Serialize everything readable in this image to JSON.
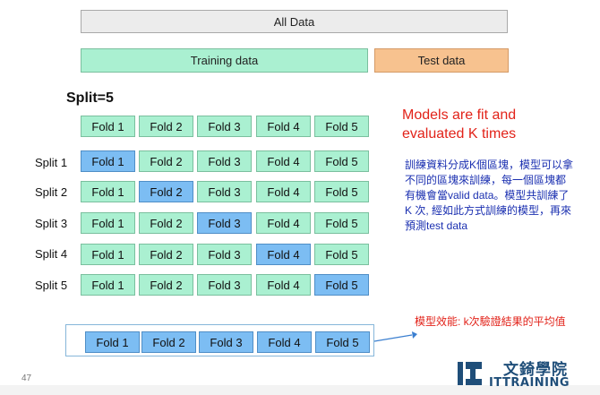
{
  "all_data": "All Data",
  "training_data": "Training data",
  "test_data": "Test data",
  "split_title": "Split=5",
  "header_folds": [
    "Fold 1",
    "Fold 2",
    "Fold 3",
    "Fold 4",
    "Fold 5"
  ],
  "splits": [
    {
      "label": "Split 1",
      "folds": [
        "Fold 1",
        "Fold 2",
        "Fold 3",
        "Fold 4",
        "Fold 5"
      ],
      "highlight": 0
    },
    {
      "label": "Split 2",
      "folds": [
        "Fold 1",
        "Fold 2",
        "Fold 3",
        "Fold 4",
        "Fold 5"
      ],
      "highlight": 1
    },
    {
      "label": "Split 3",
      "folds": [
        "Fold 1",
        "Fold 2",
        "Fold 3",
        "Fold 4",
        "Fold 5"
      ],
      "highlight": 2
    },
    {
      "label": "Split 4",
      "folds": [
        "Fold 1",
        "Fold 2",
        "Fold 3",
        "Fold 4",
        "Fold 5"
      ],
      "highlight": 3
    },
    {
      "label": "Split 5",
      "folds": [
        "Fold 1",
        "Fold 2",
        "Fold 3",
        "Fold 4",
        "Fold 5"
      ],
      "highlight": 4
    }
  ],
  "models_text": "Models are fit and evaluated K times",
  "zh_note": "訓練資料分成K個區塊，模型可以拿不同的區塊來訓練，每一個區塊都有機會當valid data。模型共訓練了K 次, 經如此方式訓練的模型，再來預測test data",
  "avg_folds": [
    "Fold 1",
    "Fold 2",
    "Fold 3",
    "Fold 4",
    "Fold 5"
  ],
  "perf_text": "模型效能: k次驗證結果的平均值",
  "page_number": "47",
  "logo": {
    "brand_zh": "文錡學院",
    "brand_en": "ITTRAINING"
  },
  "colors": {
    "train": "#aaf0d1",
    "test": "#f7c28f",
    "highlight": "#7cbdf3",
    "red": "#e2231a",
    "blue_text": "#1a2fb0"
  }
}
